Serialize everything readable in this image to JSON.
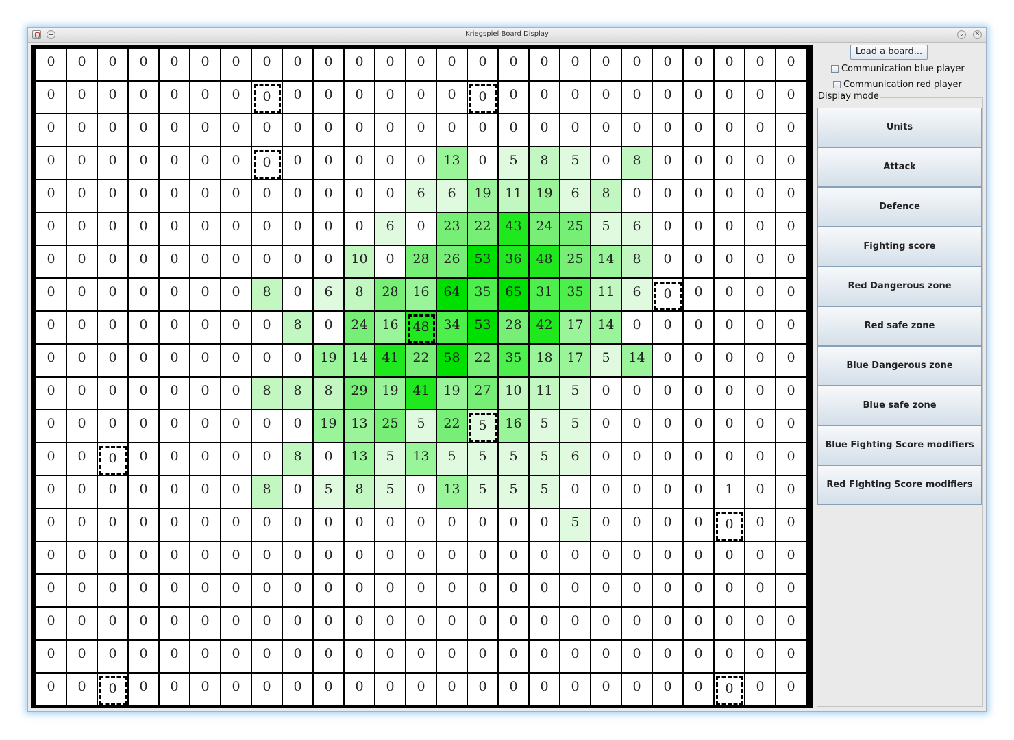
{
  "window": {
    "title": "Kriegspiel Board Display"
  },
  "panel": {
    "load_label": "Load a board...",
    "comm_blue_label": "Communication blue player",
    "comm_red_label": "Communication red player",
    "display_mode_label": "Display mode",
    "modes": [
      "Units",
      "Attack",
      "Defence",
      "Fighting score",
      "Red Dangerous zone",
      "Red safe zone",
      "Blue Dangerous zone",
      "Blue safe zone",
      "Blue Fighting Score modifiers",
      "Red FIghting Score modifiers"
    ]
  },
  "board": {
    "rows": [
      [
        0,
        0,
        0,
        0,
        0,
        0,
        0,
        0,
        0,
        0,
        0,
        0,
        0,
        0,
        0,
        0,
        0,
        0,
        0,
        0,
        0,
        0,
        0,
        0,
        0
      ],
      [
        0,
        0,
        0,
        0,
        0,
        0,
        0,
        0,
        0,
        0,
        0,
        0,
        0,
        0,
        0,
        0,
        0,
        0,
        0,
        0,
        0,
        0,
        0,
        0,
        0
      ],
      [
        0,
        0,
        0,
        0,
        0,
        0,
        0,
        0,
        0,
        0,
        0,
        0,
        0,
        0,
        0,
        0,
        0,
        0,
        0,
        0,
        0,
        0,
        0,
        0,
        0
      ],
      [
        0,
        0,
        0,
        0,
        0,
        0,
        0,
        0,
        0,
        0,
        0,
        0,
        0,
        13,
        0,
        5,
        8,
        5,
        0,
        8,
        0,
        0,
        0,
        0,
        0
      ],
      [
        0,
        0,
        0,
        0,
        0,
        0,
        0,
        0,
        0,
        0,
        0,
        0,
        6,
        6,
        19,
        11,
        19,
        6,
        8,
        0,
        0,
        0,
        0,
        0,
        0
      ],
      [
        0,
        0,
        0,
        0,
        0,
        0,
        0,
        0,
        0,
        0,
        0,
        6,
        0,
        23,
        22,
        43,
        24,
        25,
        5,
        6,
        0,
        0,
        0,
        0,
        0
      ],
      [
        0,
        0,
        0,
        0,
        0,
        0,
        0,
        0,
        0,
        0,
        10,
        0,
        28,
        26,
        53,
        36,
        48,
        25,
        14,
        8,
        0,
        0,
        0,
        0,
        0
      ],
      [
        0,
        0,
        0,
        0,
        0,
        0,
        0,
        8,
        0,
        6,
        8,
        28,
        16,
        64,
        35,
        65,
        31,
        35,
        11,
        6,
        0,
        0,
        0,
        0,
        0
      ],
      [
        0,
        0,
        0,
        0,
        0,
        0,
        0,
        0,
        8,
        0,
        24,
        16,
        48,
        34,
        53,
        28,
        42,
        17,
        14,
        0,
        0,
        0,
        0,
        0,
        0
      ],
      [
        0,
        0,
        0,
        0,
        0,
        0,
        0,
        0,
        0,
        19,
        14,
        41,
        22,
        58,
        22,
        35,
        18,
        17,
        5,
        14,
        0,
        0,
        0,
        0,
        0
      ],
      [
        0,
        0,
        0,
        0,
        0,
        0,
        0,
        8,
        8,
        8,
        29,
        19,
        41,
        19,
        27,
        10,
        11,
        5,
        0,
        0,
        0,
        0,
        0,
        0,
        0
      ],
      [
        0,
        0,
        0,
        0,
        0,
        0,
        0,
        0,
        0,
        19,
        13,
        25,
        5,
        22,
        5,
        16,
        5,
        5,
        0,
        0,
        0,
        0,
        0,
        0,
        0
      ],
      [
        0,
        0,
        0,
        0,
        0,
        0,
        0,
        0,
        8,
        0,
        13,
        5,
        13,
        5,
        5,
        5,
        5,
        6,
        0,
        0,
        0,
        0,
        0,
        0,
        0
      ],
      [
        0,
        0,
        0,
        0,
        0,
        0,
        0,
        8,
        0,
        5,
        8,
        5,
        0,
        13,
        5,
        5,
        5,
        0,
        0,
        0,
        0,
        0,
        1,
        0,
        0
      ],
      [
        0,
        0,
        0,
        0,
        0,
        0,
        0,
        0,
        0,
        0,
        0,
        0,
        0,
        0,
        0,
        0,
        0,
        5,
        0,
        0,
        0,
        0,
        0,
        0,
        0
      ],
      [
        0,
        0,
        0,
        0,
        0,
        0,
        0,
        0,
        0,
        0,
        0,
        0,
        0,
        0,
        0,
        0,
        0,
        0,
        0,
        0,
        0,
        0,
        0,
        0,
        0
      ],
      [
        0,
        0,
        0,
        0,
        0,
        0,
        0,
        0,
        0,
        0,
        0,
        0,
        0,
        0,
        0,
        0,
        0,
        0,
        0,
        0,
        0,
        0,
        0,
        0,
        0
      ],
      [
        0,
        0,
        0,
        0,
        0,
        0,
        0,
        0,
        0,
        0,
        0,
        0,
        0,
        0,
        0,
        0,
        0,
        0,
        0,
        0,
        0,
        0,
        0,
        0,
        0
      ],
      [
        0,
        0,
        0,
        0,
        0,
        0,
        0,
        0,
        0,
        0,
        0,
        0,
        0,
        0,
        0,
        0,
        0,
        0,
        0,
        0,
        0,
        0,
        0,
        0,
        0
      ],
      [
        0,
        0,
        0,
        0,
        0,
        0,
        0,
        0,
        0,
        0,
        0,
        0,
        0,
        0,
        0,
        0,
        0,
        0,
        0,
        0,
        0,
        0,
        0,
        0,
        0
      ]
    ],
    "marked_cells": [
      [
        1,
        7
      ],
      [
        1,
        14
      ],
      [
        3,
        7
      ],
      [
        7,
        20
      ],
      [
        8,
        12
      ],
      [
        11,
        14
      ],
      [
        12,
        2
      ],
      [
        14,
        22
      ],
      [
        19,
        2
      ],
      [
        19,
        22
      ]
    ],
    "colors": {
      "empty": "#ffffff",
      "level1": "#e0fae0",
      "level2": "#c2f7c2",
      "level3": "#9af59a",
      "level4": "#77ef77",
      "level5": "#4def4d",
      "level6": "#1fe81f",
      "level7": "#00e000"
    }
  }
}
